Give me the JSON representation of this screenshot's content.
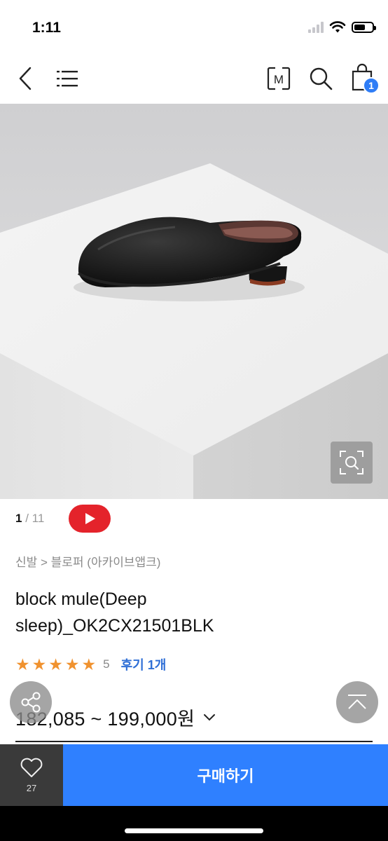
{
  "status_bar": {
    "time": "1:11"
  },
  "header": {
    "icons": [
      "back-icon",
      "menu-icon",
      "m-box-icon",
      "search-icon",
      "shopping-bag-icon"
    ],
    "cart_count": "1",
    "m_label": "M"
  },
  "gallery": {
    "current": "1",
    "total": "/ 11"
  },
  "breadcrumb": {
    "category": "신발 > 블로퍼 (아카이브앱크)"
  },
  "product": {
    "name": "block mule(Deep sleep)_OK2CX21501BLK"
  },
  "rating": {
    "stars": [
      "★",
      "★",
      "★",
      "★",
      "★"
    ],
    "score": "5",
    "reviews_label": "후기 1개",
    "value": 5
  },
  "price": {
    "range": "182,085 ~ 199,000원"
  },
  "bottom_bar": {
    "likes": "27",
    "buy_label": "구매하기"
  },
  "colors": {
    "accent": "#2f80ff",
    "link": "#2f6fd6",
    "star": "#f0922f",
    "youtube": "#e4232b",
    "like_bg": "#3a3a3a"
  }
}
